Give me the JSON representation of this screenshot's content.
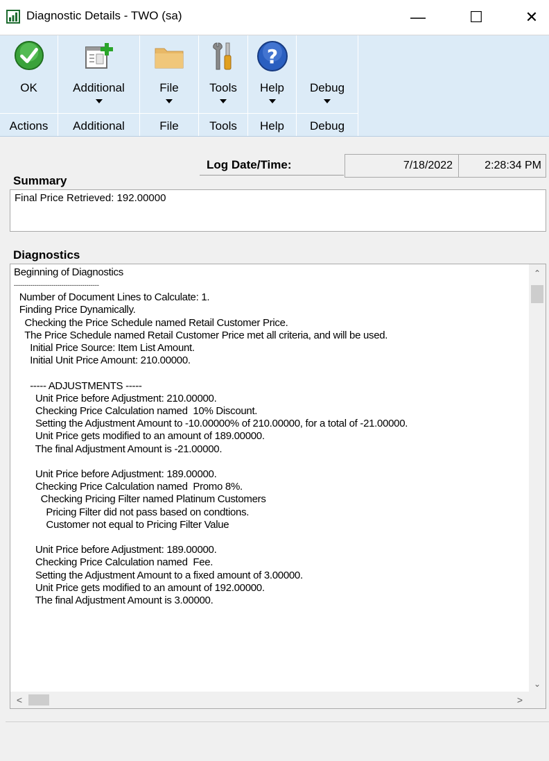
{
  "window": {
    "title": "Diagnostic Details  -  TWO (sa)",
    "minimize_glyph": "—",
    "maximize_glyph": "☐",
    "close_glyph": "✕"
  },
  "ribbon": {
    "groups": [
      {
        "button_label": "OK",
        "group_label": "Actions",
        "icon": "ok-checkmark-icon",
        "has_dropdown": false
      },
      {
        "button_label": "Additional",
        "group_label": "Additional",
        "icon": "additional-window-add-icon",
        "has_dropdown": true
      },
      {
        "button_label": "File",
        "group_label": "File",
        "icon": "folder-icon",
        "has_dropdown": true
      },
      {
        "button_label": "Tools",
        "group_label": "Tools",
        "icon": "tools-wrench-screwdriver-icon",
        "has_dropdown": true
      },
      {
        "button_label": "Help",
        "group_label": "Help",
        "icon": "help-question-icon",
        "has_dropdown": true
      },
      {
        "button_label": "Debug",
        "group_label": "Debug",
        "icon": "",
        "has_dropdown": true
      }
    ],
    "background_color": "#dcebf7"
  },
  "log": {
    "label": "Log Date/Time:",
    "date": "7/18/2022",
    "time": "2:28:34 PM"
  },
  "summary": {
    "label": "Summary",
    "text": "Final Price Retrieved: 192.00000"
  },
  "diagnostics": {
    "label": "Diagnostics",
    "lines": [
      "Beginning of Diagnostics",
      "-----------------------------------------",
      "  Number of Document Lines to Calculate: 1.",
      "  Finding Price Dynamically.",
      "    Checking the Price Schedule named Retail Customer Price.",
      "    The Price Schedule named Retail Customer Price met all criteria, and will be used.",
      "      Initial Price Source: Item List Amount.",
      "      Initial Unit Price Amount: 210.00000.",
      "",
      "      ----- ADJUSTMENTS -----",
      "        Unit Price before Adjustment: 210.00000.",
      "        Checking Price Calculation named  10% Discount.",
      "        Setting the Adjustment Amount to -10.00000% of 210.00000, for a total of -21.00000.",
      "        Unit Price gets modified to an amount of 189.00000.",
      "        The final Adjustment Amount is -21.00000.",
      "",
      "        Unit Price before Adjustment: 189.00000.",
      "        Checking Price Calculation named  Promo 8%.",
      "          Checking Pricing Filter named Platinum Customers",
      "            Pricing Filter did not pass based on condtions.",
      "            Customer not equal to Pricing Filter Value",
      "",
      "        Unit Price before Adjustment: 189.00000.",
      "        Checking Price Calculation named  Fee.",
      "        Setting the Adjustment Amount to a fixed amount of 3.00000.",
      "        Unit Price gets modified to an amount of 192.00000.",
      "        The final Adjustment Amount is 3.00000."
    ]
  },
  "scrollbars": {
    "up_glyph": "⌃",
    "down_glyph": "⌄",
    "left_glyph": "<",
    "right_glyph": ">"
  }
}
